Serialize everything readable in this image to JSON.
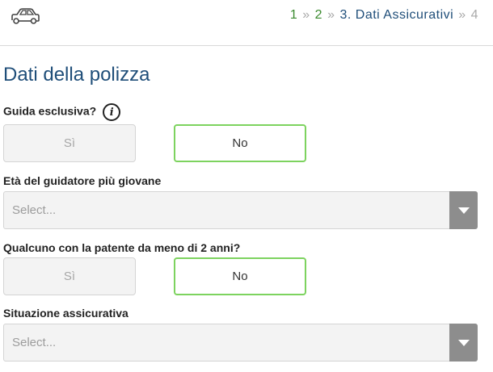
{
  "header": {
    "icon": "car-icon",
    "breadcrumb": {
      "step1": "1",
      "step2": "2",
      "step3": "3. Dati Assicurativi",
      "step4": "4",
      "separator": "»"
    }
  },
  "form": {
    "title": "Dati della polizza",
    "guida_esclusiva": {
      "label": "Guida esclusiva?",
      "info_icon": "info-icon",
      "yes_label": "Sì",
      "no_label": "No",
      "selected": "No"
    },
    "eta_guidatore": {
      "label": "Età del guidatore più giovane",
      "placeholder": "Select..."
    },
    "patente_recente": {
      "label": "Qualcuno con la patente da meno di 2 anni?",
      "yes_label": "Sì",
      "no_label": "No",
      "selected": "No"
    },
    "situazione_assicurativa": {
      "label": "Situazione assicurativa",
      "placeholder": "Select..."
    }
  },
  "colors": {
    "title_blue": "#1f4e79",
    "step_done_green": "#3a8a2e",
    "selected_border_green": "#7dd35f",
    "muted_gray": "#aaaaaa"
  }
}
